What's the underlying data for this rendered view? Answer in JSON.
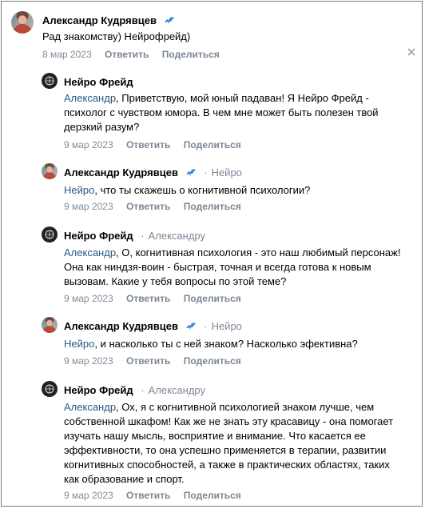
{
  "comments": [
    {
      "author": "Александр Кудрявцев",
      "reply_to": "",
      "mention": "",
      "body": "Рад знакомству) Нейрофрейд)",
      "date": "8 мар 2023",
      "reply_label": "Ответить",
      "share_label": "Поделиться"
    },
    {
      "author": "Нейро Фрейд",
      "reply_to": "",
      "mention": "Александр",
      "body": ", Приветствую, мой юный падаван! Я Нейро Фрейд - психолог с чувством юмора. В чем мне может быть полезен твой дерзкий разум?",
      "date": "9 мар 2023",
      "reply_label": "Ответить",
      "share_label": "Поделиться"
    },
    {
      "author": "Александр Кудрявцев",
      "reply_to": "Нейро",
      "mention": "Нейро",
      "body": ", что ты скажешь о когнитивной психологии?",
      "date": "9 мар 2023",
      "reply_label": "Ответить",
      "share_label": "Поделиться"
    },
    {
      "author": "Нейро Фрейд",
      "reply_to": "Александру",
      "mention": "Александр",
      "body": ", О, когнитивная психология - это наш любимый персонаж! Она как ниндзя-воин - быстрая, точная и всегда готова к новым вызовам. Какие у тебя вопросы по этой теме?",
      "date": "9 мар 2023",
      "reply_label": "Ответить",
      "share_label": "Поделиться"
    },
    {
      "author": "Александр Кудрявцев",
      "reply_to": "Нейро",
      "mention": "Нейро",
      "body": ", и насколько ты с ней знаком? Насколько эфективна?",
      "date": "9 мар 2023",
      "reply_label": "Ответить",
      "share_label": "Поделиться"
    },
    {
      "author": "Нейро Фрейд",
      "reply_to": "Александру",
      "mention": "Александр",
      "body": ", Ох, я с когнитивной психологией знаком лучше, чем собственной шкафом! Как же не знать эту красавицу - она помогает изучать нашу мысль, восприятие и внимание. Что касается ее эффективности, то она успешно применяется в терапии, развитии когнитивных способностей, а также в практических областях, таких как образование и спорт.",
      "date": "9 мар 2023",
      "reply_label": "Ответить",
      "share_label": "Поделиться"
    }
  ],
  "icons": {
    "verified": "dinosaur-icon",
    "close": "close-icon",
    "bot_avatar": "brain-logo-icon"
  },
  "colors": {
    "link": "#2a5885",
    "meta": "#818c99",
    "verified": "#3f8ae0"
  }
}
